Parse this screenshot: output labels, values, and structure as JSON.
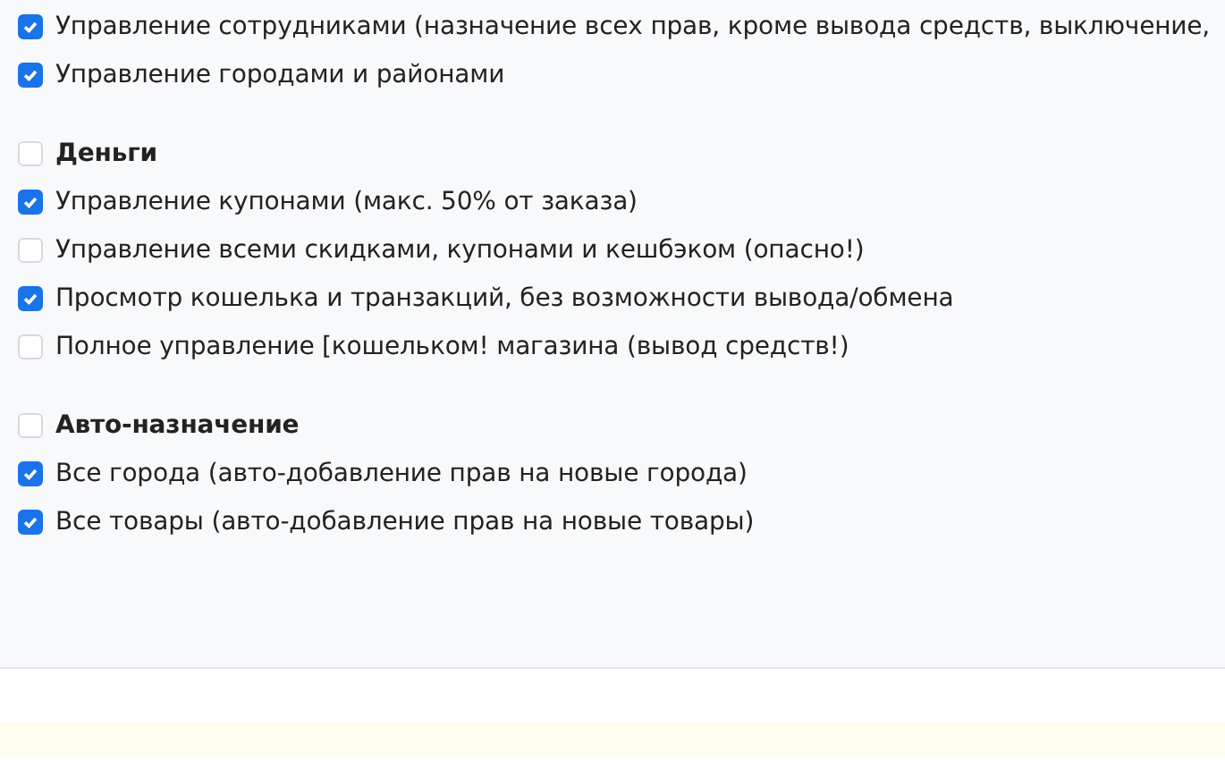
{
  "sections": [
    {
      "items": [
        {
          "label": "Управление сотрудниками (назначение всех прав, кроме вывода средств, выключение,",
          "checked": true
        },
        {
          "label": "Управление городами и районами",
          "checked": true
        }
      ]
    },
    {
      "title": "Деньги",
      "checked": false,
      "items": [
        {
          "label": "Управление купонами (макс. 50% от заказа)",
          "checked": true
        },
        {
          "label": "Управление всеми скидками, купонами и кешбэком (опасно!)",
          "checked": false
        },
        {
          "label": "Просмотр кошелька и транзакций, без возможности вывода/обмена",
          "checked": true
        },
        {
          "label": "Полное управление [кошельком! магазина (вывод средств!)",
          "checked": false
        }
      ]
    },
    {
      "title": "Авто-назначение",
      "checked": false,
      "items": [
        {
          "label": "Все города (авто-добавление прав на новые города)",
          "checked": true
        },
        {
          "label": "Все товары (авто-добавление прав на новые товары)",
          "checked": true
        }
      ]
    }
  ]
}
